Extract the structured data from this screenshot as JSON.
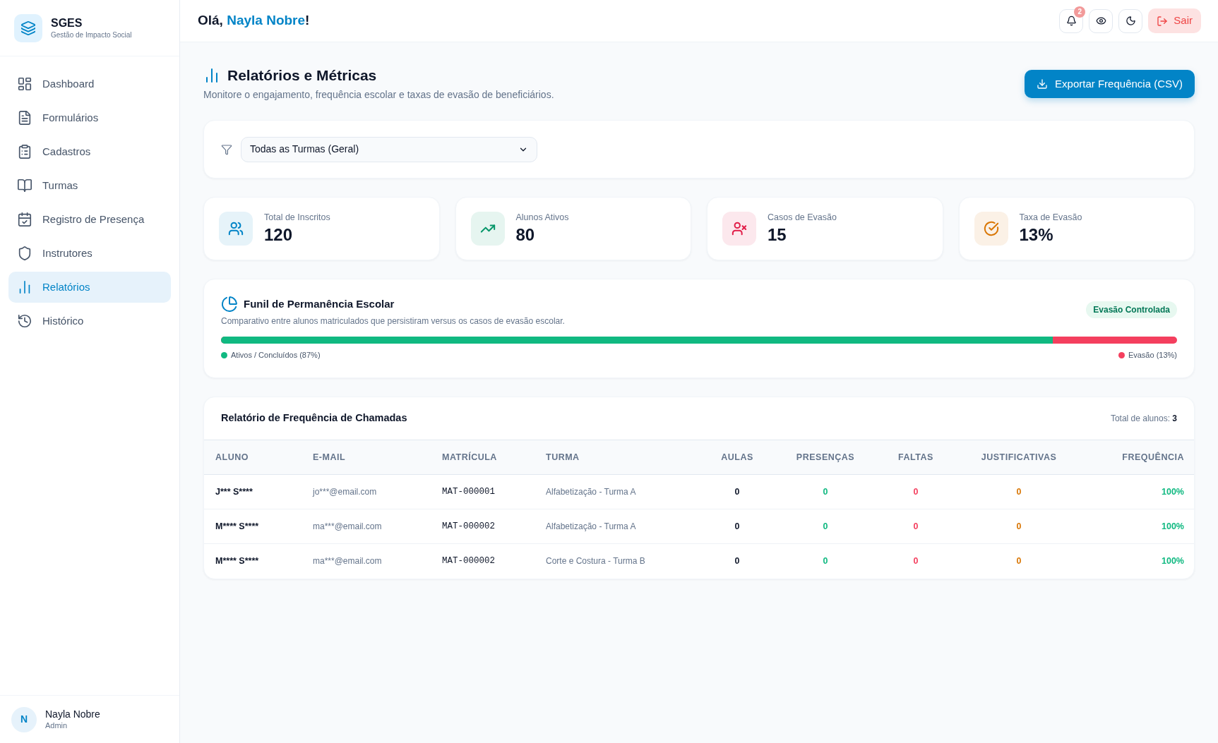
{
  "sidebar": {
    "brand": {
      "name": "SGES",
      "tagline": "Gestão de Impacto Social"
    },
    "items": [
      {
        "label": "Dashboard",
        "selected": false
      },
      {
        "label": "Formulários",
        "selected": false
      },
      {
        "label": "Cadastros",
        "selected": false
      },
      {
        "label": "Turmas",
        "selected": false
      },
      {
        "label": "Registro de Presença",
        "selected": false
      },
      {
        "label": "Instrutores",
        "selected": false
      },
      {
        "label": "Relatórios",
        "selected": true
      },
      {
        "label": "Histórico",
        "selected": false
      }
    ],
    "user": {
      "initial": "N",
      "name": "Nayla Nobre",
      "role": "Admin"
    }
  },
  "header": {
    "greeting": {
      "text": "Olá,",
      "name": "Nayla Nobre",
      "suffix": "!"
    },
    "notification_count": "2",
    "logout_label": "Sair"
  },
  "page": {
    "title": "Relatórios e Métricas",
    "subtitle": "Monitore o engajamento, frequência escolar e taxas de evasão de beneficiários.",
    "export_button": "Exportar Frequência (CSV)"
  },
  "filter": {
    "value": "Todas as Turmas (Geral)"
  },
  "stats": [
    {
      "label": "Total de Inscritos",
      "value": "120",
      "color": "#0284c7"
    },
    {
      "label": "Alunos Ativos",
      "value": "80",
      "color": "#059669"
    },
    {
      "label": "Casos de Evasão",
      "value": "15",
      "color": "#e11d48"
    },
    {
      "label": "Taxa de Evasão",
      "value": "13%",
      "color": "#d97706"
    }
  ],
  "funnel": {
    "title": "Funil de Permanência Escolar",
    "subtitle": "Comparativo entre alunos matriculados que persistiram versus os casos de evasão escolar.",
    "badge": "Evasão Controlada",
    "level": 0.87,
    "legend": [
      {
        "label": "Ativos / Concluídos (87%)",
        "color": "#10b981"
      },
      {
        "label": "Evasão (13%)",
        "color": "#f43f5e"
      }
    ]
  },
  "table": {
    "title": "Relatório de Frequência de Chamadas",
    "total": "Total de alunos: **3**",
    "columns": [
      {
        "label": "ALUNO",
        "kind": "name"
      },
      {
        "label": "E-MAIL",
        "kind": "email"
      },
      {
        "label": "MATRÍCULA",
        "kind": "code"
      },
      {
        "label": "TURMA",
        "kind": "text"
      },
      {
        "label": "AULAS",
        "kind": "count"
      },
      {
        "label": "PRESENÇAS",
        "kind": "present"
      },
      {
        "label": "FALTAS",
        "kind": "absent"
      },
      {
        "label": "JUSTIFICATIVAS",
        "kind": "justified"
      },
      {
        "label": "FREQUÊNCIA",
        "kind": "rate"
      }
    ],
    "rows": [
      {
        "cells": [
          "J*** S****",
          "jo***@email.com",
          "MAT-000001",
          "Alfabetização - Turma A",
          "0",
          "0",
          "0",
          "0",
          "100%"
        ]
      },
      {
        "cells": [
          "M**** S****",
          "ma***@email.com",
          "MAT-000002",
          "Alfabetização - Turma A",
          "0",
          "0",
          "0",
          "0",
          "100%"
        ]
      },
      {
        "cells": [
          "M**** S****",
          "ma***@email.com",
          "MAT-000002",
          "Corte e Costura - Turma B",
          "0",
          "0",
          "0",
          "0",
          "100%"
        ]
      }
    ]
  }
}
